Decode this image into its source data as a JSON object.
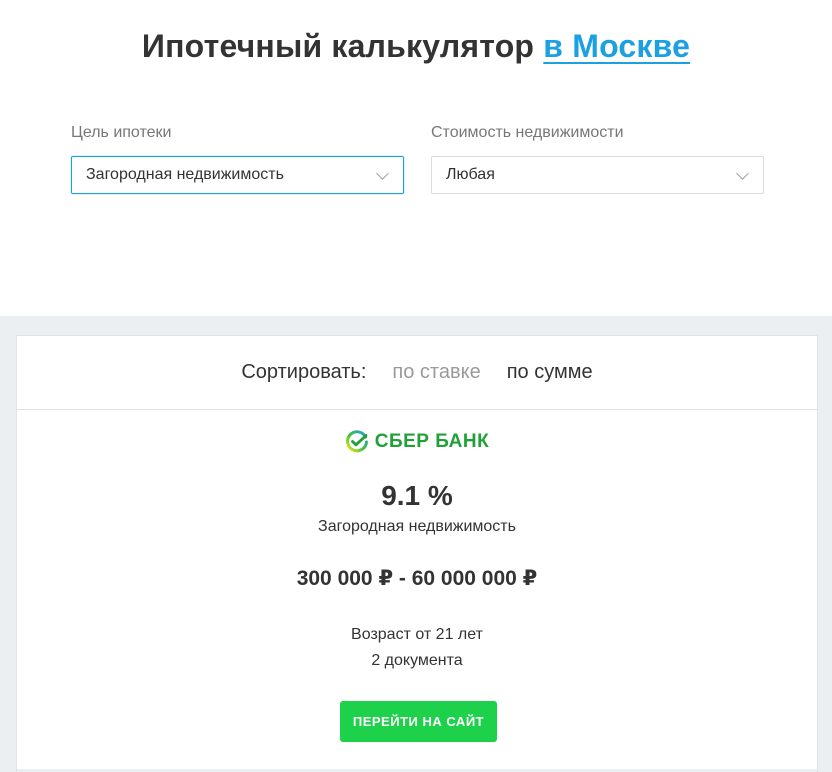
{
  "page": {
    "title_main": "Ипотечный калькулятор",
    "title_city": "в Москве"
  },
  "filters": {
    "purpose": {
      "label": "Цель ипотеки",
      "value": "Загородная недвижимость"
    },
    "cost": {
      "label": "Стоимость недвижимости",
      "value": "Любая"
    }
  },
  "sort": {
    "label": "Сортировать:",
    "options": [
      {
        "label": "по ставке",
        "state": "inactive"
      },
      {
        "label": "по сумме",
        "state": "selected"
      }
    ]
  },
  "offer": {
    "bank_name": "СБЕР БАНК",
    "rate": "9.1 %",
    "purpose": "Загородная недвижимость",
    "amount_range": "300 000 ₽ - 60 000 000 ₽",
    "requirements": [
      "Возраст от 21 лет",
      "2 документа"
    ],
    "cta_label": "ПЕРЕЙТИ НА САЙТ"
  },
  "colors": {
    "accent": "#1ba1e2",
    "cta": "#1dd14b",
    "bank_green": "#21a038",
    "background_section": "#ebeff1"
  },
  "icons": {
    "select_arrow": "chevron-down-icon",
    "bank_logo": "sber-logo-icon"
  }
}
